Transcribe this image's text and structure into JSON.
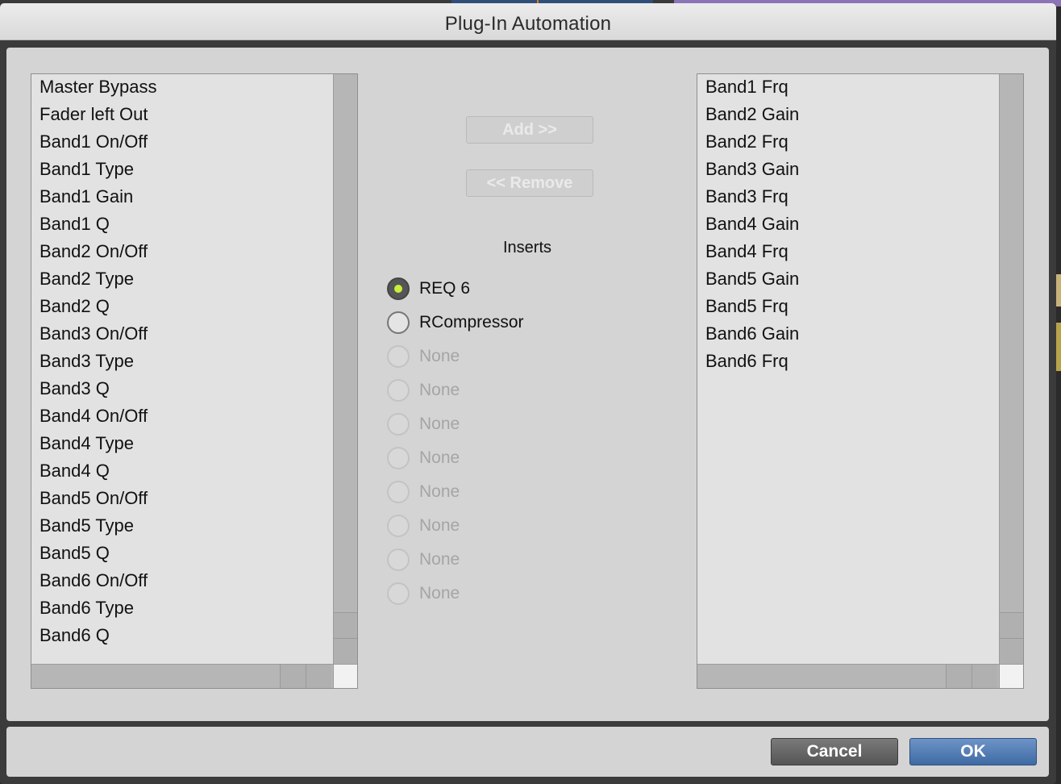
{
  "window": {
    "title": "Plug-In Automation"
  },
  "available_params": {
    "items": [
      "Master Bypass",
      "Fader left Out",
      "Band1 On/Off",
      "Band1 Type",
      "Band1 Gain",
      "Band1 Q",
      "Band2 On/Off",
      "Band2 Type",
      "Band2 Q",
      "Band3 On/Off",
      "Band3 Type",
      "Band3 Q",
      "Band4 On/Off",
      "Band4 Type",
      "Band4 Q",
      "Band5 On/Off",
      "Band5 Type",
      "Band5 Q",
      "Band6 On/Off",
      "Band6 Type",
      "Band6 Q"
    ]
  },
  "automated_params": {
    "items": [
      "Band1 Frq",
      "Band2 Gain",
      "Band2 Frq",
      "Band3 Gain",
      "Band3 Frq",
      "Band4 Gain",
      "Band4 Frq",
      "Band5 Gain",
      "Band5 Frq",
      "Band6 Gain",
      "Band6 Frq"
    ]
  },
  "buttons": {
    "add": "Add >>",
    "remove": "<< Remove",
    "cancel": "Cancel",
    "ok": "OK"
  },
  "inserts": {
    "label": "Inserts",
    "options": [
      {
        "label": "REQ 6",
        "checked": true,
        "enabled": true
      },
      {
        "label": "RCompressor",
        "checked": false,
        "enabled": true
      },
      {
        "label": "None",
        "checked": false,
        "enabled": false
      },
      {
        "label": "None",
        "checked": false,
        "enabled": false
      },
      {
        "label": "None",
        "checked": false,
        "enabled": false
      },
      {
        "label": "None",
        "checked": false,
        "enabled": false
      },
      {
        "label": "None",
        "checked": false,
        "enabled": false
      },
      {
        "label": "None",
        "checked": false,
        "enabled": false
      },
      {
        "label": "None",
        "checked": false,
        "enabled": false
      },
      {
        "label": "None",
        "checked": false,
        "enabled": false
      }
    ]
  },
  "colors": {
    "ok_button": "#4a75ad",
    "cancel_button": "#666666",
    "radio_selected_dot": "#c8f03a"
  }
}
